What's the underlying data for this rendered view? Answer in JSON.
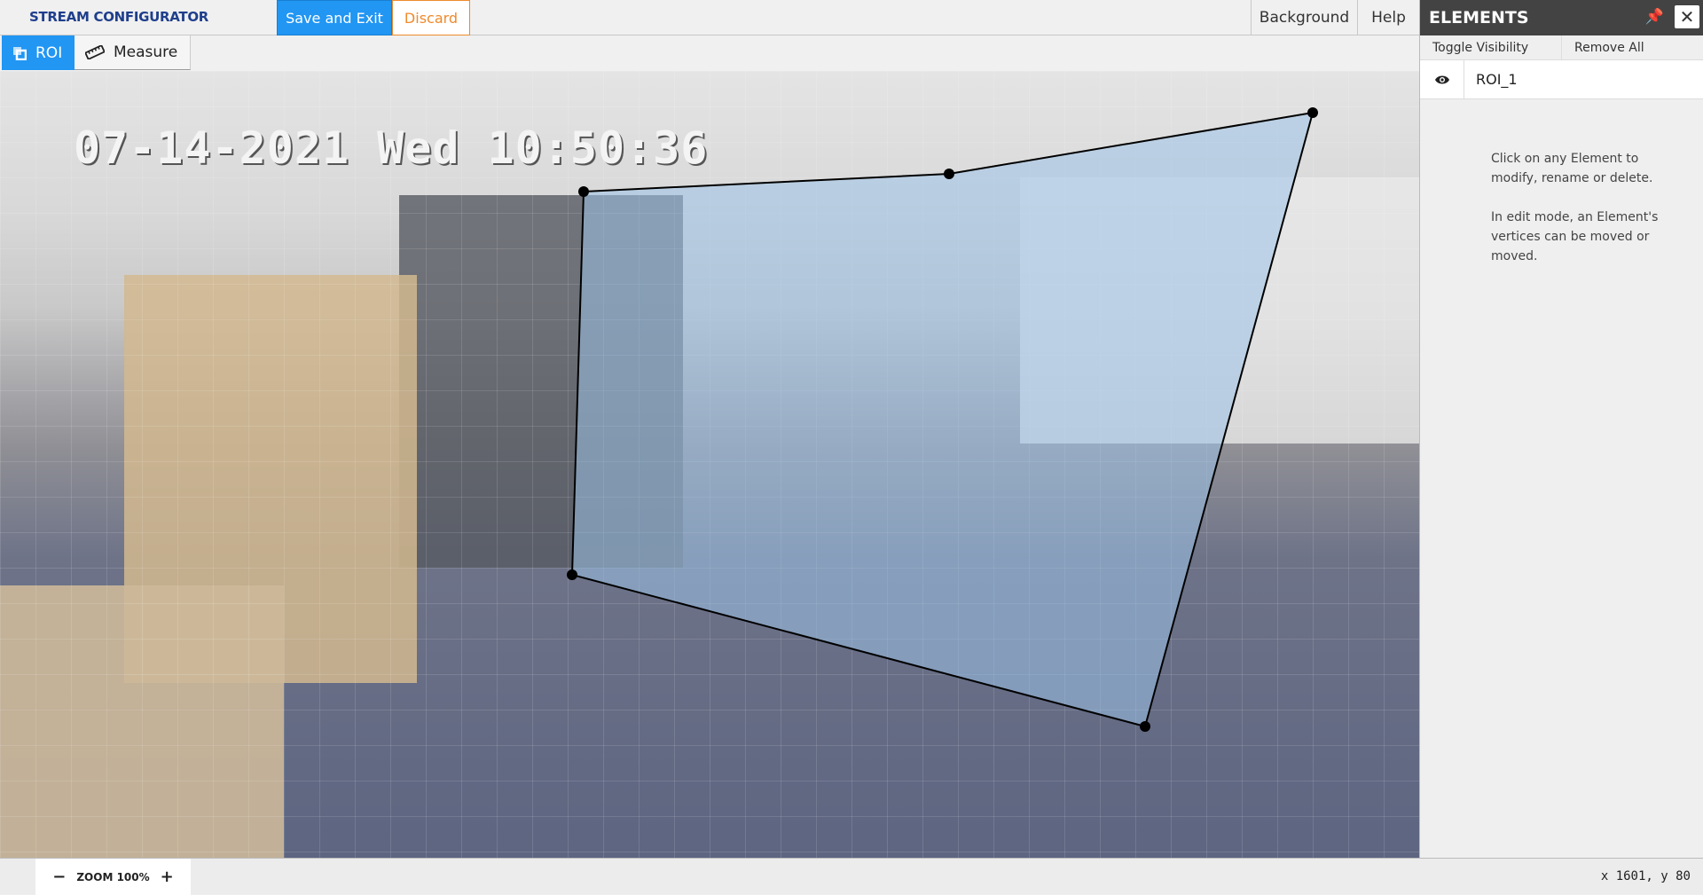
{
  "app": {
    "title": "STREAM CONFIGURATOR"
  },
  "toolbar": {
    "save_label": "Save and Exit",
    "discard_label": "Discard",
    "background_label": "Background",
    "help_label": "Help"
  },
  "tools": [
    {
      "label": "ROI",
      "icon": "roi-icon",
      "active": true
    },
    {
      "label": "Measure",
      "icon": "ruler-icon",
      "active": false
    }
  ],
  "canvas": {
    "timestamp": "07-14-2021 Wed 10:50:36",
    "roi_fill": "#9cc3e8",
    "roi_stroke": "#000000"
  },
  "zoom": {
    "minus": "−",
    "label": "ZOOM 100%",
    "plus": "+"
  },
  "status": {
    "coords": "x 1601, y 80"
  },
  "panel": {
    "title": "ELEMENTS",
    "toggle_label": "Toggle Visibility",
    "remove_label": "Remove All",
    "items": [
      {
        "name": "ROI_1",
        "visible": true
      }
    ],
    "hint1": "Click on any Element to modify, rename or delete.",
    "hint2": "In edit mode, an Element's vertices can be moved or moved."
  },
  "colors": {
    "accent": "#2196f3",
    "discard": "#ef8a2b",
    "panel_header": "#434343",
    "brand": "#1f3f8c"
  }
}
